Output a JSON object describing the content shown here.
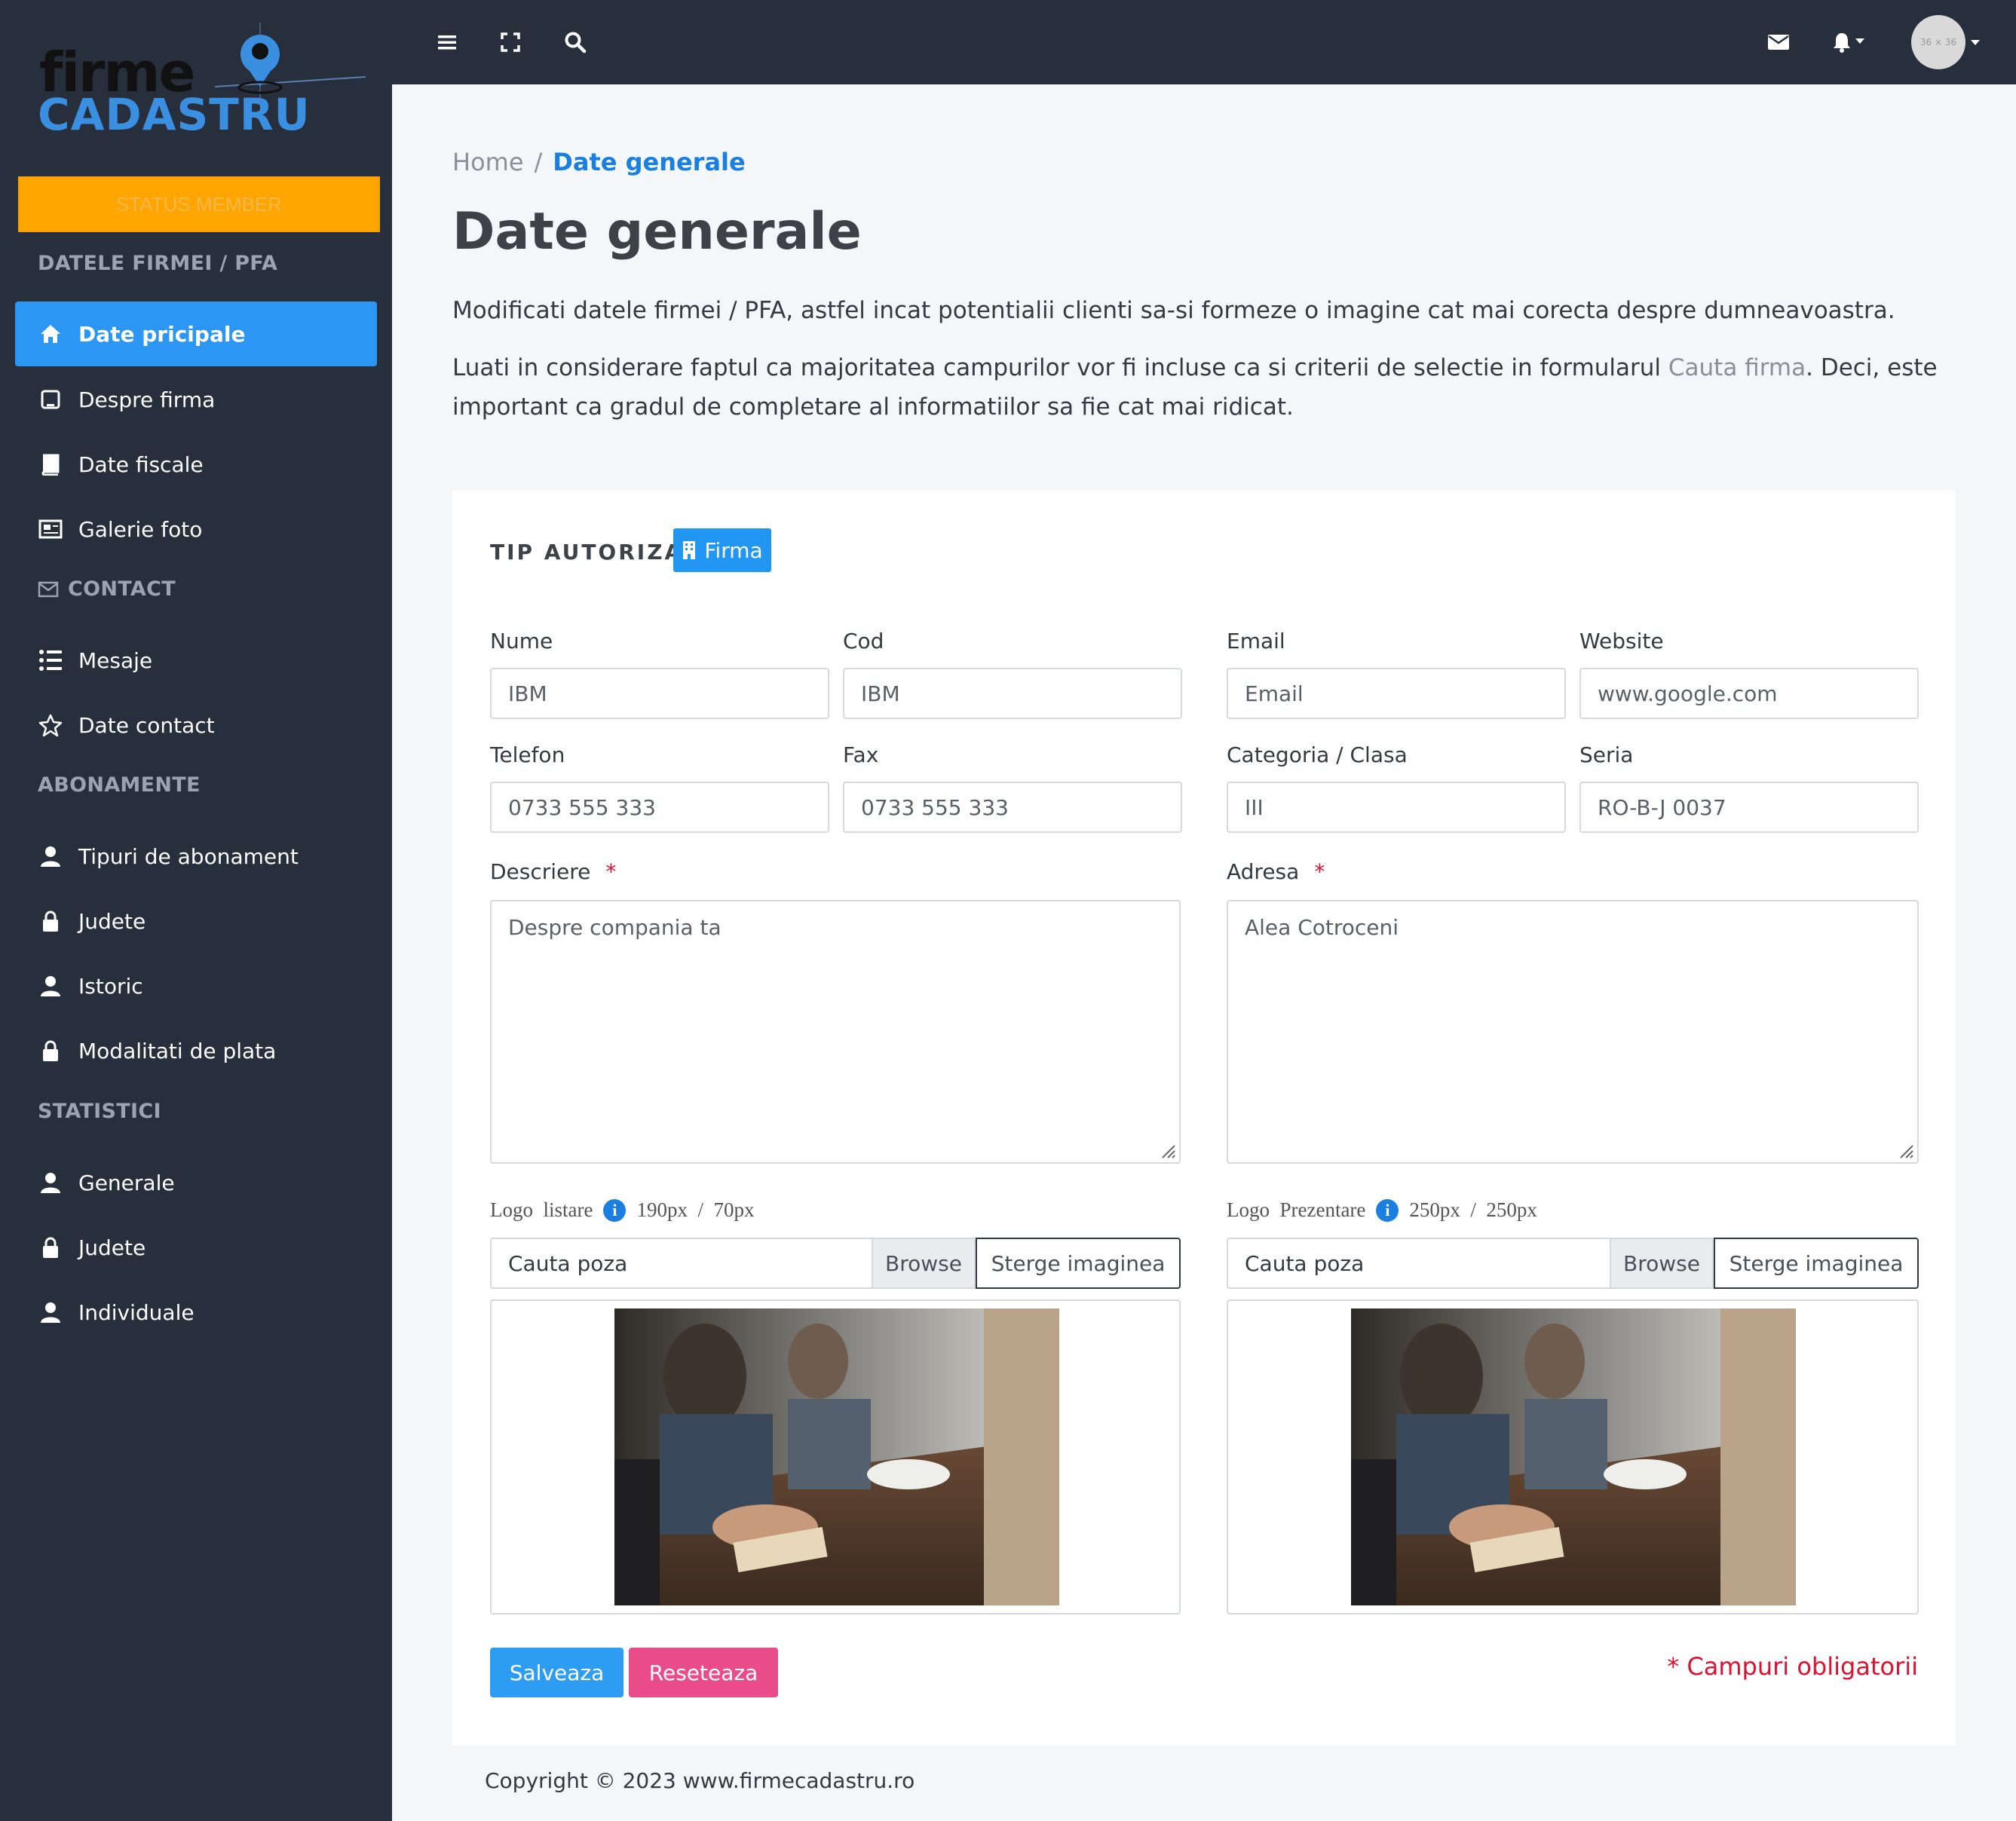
{
  "brand": {
    "line1": "firme",
    "line2": "CADASTRU"
  },
  "sidebar": {
    "status_button": "STATUS MEMBER",
    "section_firma": "DATELE FIRMEI / PFA",
    "items_firma": [
      {
        "label": "Date pricipale",
        "icon": "home-icon",
        "active": true
      },
      {
        "label": "Despre firma",
        "icon": "tablet-icon"
      },
      {
        "label": "Date fiscale",
        "icon": "book-icon"
      },
      {
        "label": "Galerie foto",
        "icon": "newspaper-icon"
      }
    ],
    "section_contact": "CONTACT",
    "items_contact": [
      {
        "label": "Mesaje",
        "icon": "list-icon"
      },
      {
        "label": "Date contact",
        "icon": "star-icon"
      }
    ],
    "section_abonamente": "ABONAMENTE",
    "items_abonamente": [
      {
        "label": "Tipuri de abonament",
        "icon": "user-icon"
      },
      {
        "label": "Judete",
        "icon": "lock-icon"
      },
      {
        "label": "Istoric",
        "icon": "user-icon"
      },
      {
        "label": "Modalitati de plata",
        "icon": "lock-icon"
      }
    ],
    "section_statistici": "STATISTICI",
    "items_statistici": [
      {
        "label": "Generale",
        "icon": "user-icon"
      },
      {
        "label": "Judete",
        "icon": "lock-icon"
      },
      {
        "label": "Individuale",
        "icon": "user-icon"
      }
    ]
  },
  "topbar": {
    "icons": [
      "menu-icon",
      "fullscreen-icon",
      "search-icon",
      "envelope-icon",
      "bell-icon"
    ],
    "avatar_text": "36 × 36"
  },
  "breadcrumb": {
    "home": "Home",
    "separator": "/",
    "current": "Date generale"
  },
  "page": {
    "title": "Date generale",
    "intro1": "Modificati datele firmei / PFA, astfel incat potentialii clienti sa-si formeze o imagine cat mai corecta despre dumneavoastra.",
    "intro2_before": "Luati in considerare faptul ca majoritatea campurilor vor fi incluse ca si criterii de selectie in formularul ",
    "intro2_link": "Cauta firma",
    "intro2_after": ". Deci, este important ca gradul de completare al informatiilor sa fie cat mai ridicat."
  },
  "form": {
    "tip_label": "TIP AUTORIZAT",
    "tip_value": "Firma",
    "nume": {
      "label": "Nume",
      "value": "IBM"
    },
    "cod": {
      "label": "Cod",
      "value": "IBM"
    },
    "email": {
      "label": "Email",
      "placeholder": "Email"
    },
    "website": {
      "label": "Website",
      "value": "www.google.com"
    },
    "telefon": {
      "label": "Telefon",
      "value": "0733 555 333"
    },
    "fax": {
      "label": "Fax",
      "value": "0733 555 333"
    },
    "categoria": {
      "label": "Categoria / Clasa",
      "value": "III"
    },
    "seria": {
      "label": "Seria",
      "value": "RO-B-J 0037"
    },
    "descriere": {
      "label": "Descriere",
      "required": "*",
      "placeholder": "Despre compania ta"
    },
    "adresa": {
      "label": "Adresa",
      "required": "*",
      "value": "Alea Cotroceni"
    },
    "logo_listare": {
      "label": "Logo  listare",
      "size": "190px  /  70px",
      "file_placeholder": "Cauta poza",
      "browse": "Browse",
      "delete": "Sterge imaginea"
    },
    "logo_prezentare": {
      "label": "Logo  Prezentare",
      "size": "250px  /  250px",
      "file_placeholder": "Cauta poza",
      "browse": "Browse",
      "delete": "Sterge imaginea"
    },
    "save": "Salveaza",
    "reset": "Reseteaza",
    "required_note": "* Campuri obligatorii"
  },
  "footer": {
    "text": "Copyright © 2023 www.firmecadastru.ro"
  },
  "colors": {
    "sidebar": "#272f3d",
    "accent": "#2b96f3",
    "status": "#ffa500",
    "reset": "#ea4c89",
    "required": "#e01030"
  }
}
